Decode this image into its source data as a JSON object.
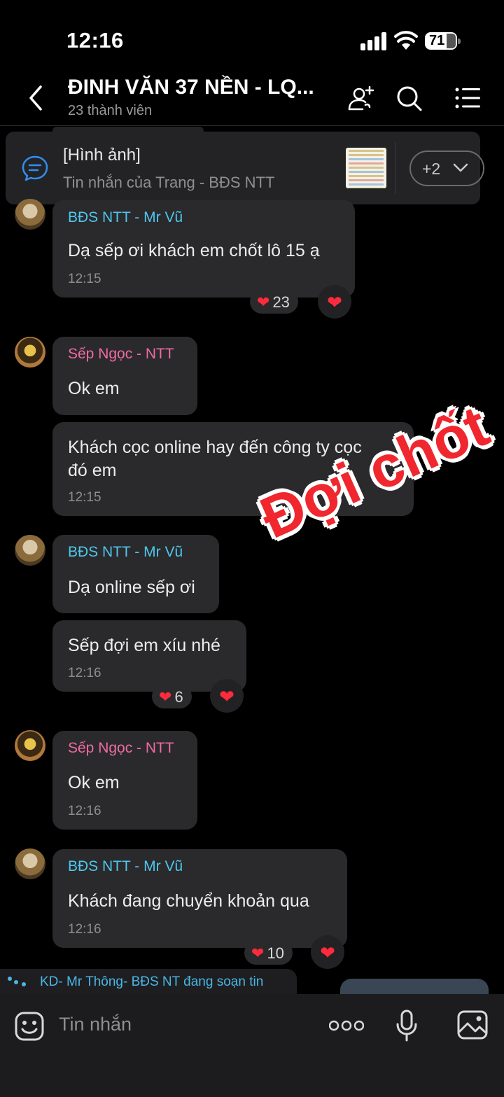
{
  "status": {
    "time": "12:16",
    "battery": "71"
  },
  "header": {
    "title": "ĐINH VĂN 37 NỀN - LQ...",
    "subtitle": "23 thành viên"
  },
  "pinned": {
    "title": "[Hình ảnh]",
    "subtitle": "Tin nhắn của Trang - BĐS NTT",
    "more_label": "+2"
  },
  "messages": [
    {
      "sender": "BĐS NTT - Mr Vũ",
      "text": "Dạ sếp ơi khách em chốt lô 15 ạ",
      "time": "12:15",
      "reaction_count": "23"
    },
    {
      "sender": "Sếp Ngọc - NTT",
      "text": "Ok em"
    },
    {
      "text_line1": "Khách cọc online hay đến công ty cọc",
      "text_line2": "đó em",
      "time": "12:15"
    },
    {
      "sender": "BĐS NTT - Mr Vũ",
      "text": "Dạ online sếp ơi"
    },
    {
      "text": "Sếp đợi em xíu nhé",
      "time": "12:16",
      "reaction_count": "6"
    },
    {
      "sender": "Sếp Ngọc - NTT",
      "text": "Ok em",
      "time": "12:16"
    },
    {
      "sender": "BĐS NTT - Mr Vũ",
      "text": "Khách đang chuyển khoản qua",
      "time": "12:16",
      "reaction_count": "10"
    }
  ],
  "sticker": "Đợi chốt",
  "typing": "KD- Mr Thông- BĐS NT đang soạn tin",
  "composer": {
    "placeholder": "Tin nhắn"
  },
  "colors": {
    "accent_blue": "#4ec7ee",
    "accent_pink": "#f06aa5",
    "heart": "#ff2b3d",
    "bubble": "#2a2a2c"
  },
  "icons": [
    "back-icon",
    "add-member-icon",
    "search-icon",
    "menu-list-icon",
    "chat-bubble-icon",
    "emoji-icon",
    "more-icon",
    "mic-icon",
    "image-icon"
  ]
}
